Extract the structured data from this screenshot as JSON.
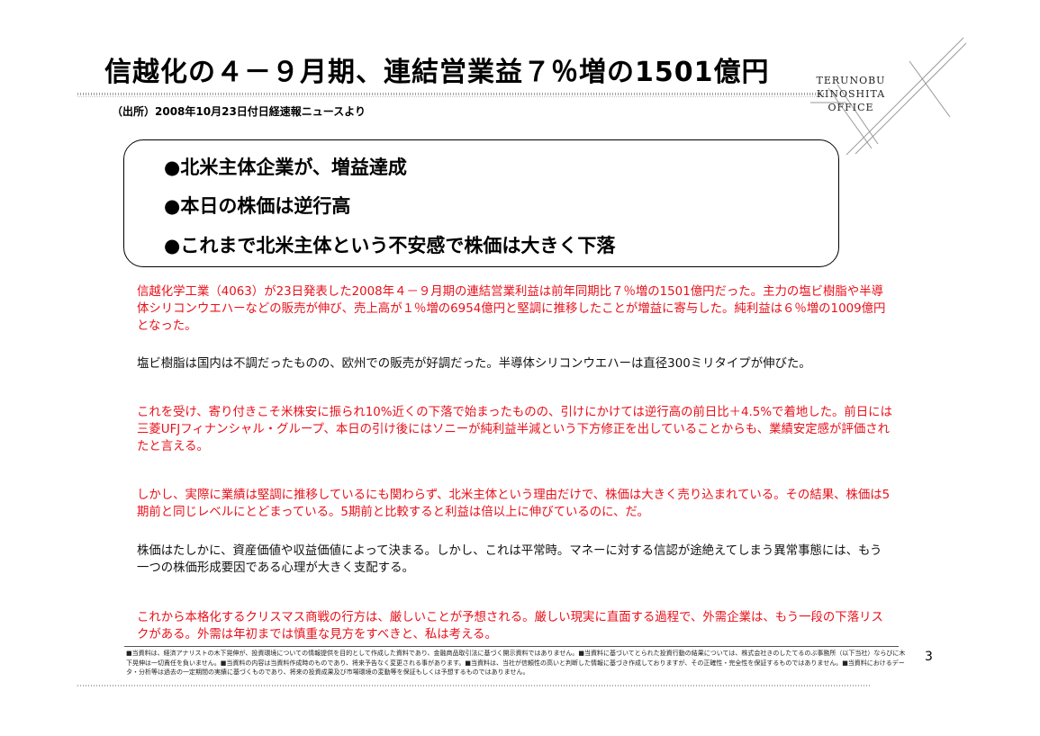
{
  "title": "信越化の４－９月期、連結営業益７％増の1501億円",
  "source": "（出所）2008年10月23日付日経速報ニュースより",
  "logo": {
    "line1": "TERUNOBU",
    "line2": "KINOSHITA",
    "line3": "OFFICE"
  },
  "summary": [
    "●北米主体企業が、増益達成",
    "●本日の株価は逆行高",
    "●これまで北米主体という不安感で株価は大きく下落"
  ],
  "paragraphs": [
    "信越化学工業（4063）が23日発表した2008年４－９月期の連結営業利益は前年同期比７％増の1501億円だった。主力の塩ビ樹脂や半導体シリコンウエハーなどの販売が伸び、売上高が１％増の6954億円と堅調に推移したことが増益に寄与した。純利益は６％増の1009億円となった。",
    "塩ビ樹脂は国内は不調だったものの、欧州での販売が好調だった。半導体シリコンウエハーは直径300ミリタイプが伸びた。",
    "これを受け、寄り付きこそ米株安に振られ10%近くの下落で始まったものの、引けにかけては逆行高の前日比＋4.5%で着地した。前日には三菱UFJフィナンシャル・グループ、本日の引け後にはソニーが純利益半減という下方修正を出していることからも、業績安定感が評価されたと言える。",
    "しかし、実際に業績は堅調に推移しているにも関わらず、北米主体という理由だけで、株価は大きく売り込まれている。その結果、株価は5期前と同じレベルにとどまっている。5期前と比較すると利益は倍以上に伸びているのに、だ。",
    " 株価はたしかに、資産価値や収益価値によって決まる。しかし、これは平常時。マネーに対する信認が途絶えてしまう異常事態には、もう一つの株価形成要因である心理が大きく支配する。",
    "これから本格化するクリスマス商戦の行方は、厳しいことが予想される。厳しい現実に直面する過程で、外需企業は、もう一段の下落リスクがある。外需は年初までは慎重な見方をすべきと、私は考える。"
  ],
  "disclaimer": "■当資料は、経済アナリストの木下晃伸が、投資環境についての情報提供を目的として作成した資料であり、金融商品取引法に基づく開示資料ではありません。■当資料に基づいてとられた投資行動の結果については、株式会社きのしたてるのぶ事務所（以下当社）ならびに木下晃伸は一切責任を負いません。■当資料の内容は当資料作成時のものであり、将来予告なく変更される事があります。■当資料は、当社が信頼性の高いと判断した情報に基づき作成しておりますが、その正確性・完全性を保証するものではありません。■当資料におけるデータ・分析等は過去の一定期間の実績に基づくものであり、将来の投資成果及び市場環境の変動等を保証もしくは予想するものではありません。",
  "page_number": "3",
  "colors": {
    "highlight": "#e8101a",
    "text": "#111111"
  }
}
